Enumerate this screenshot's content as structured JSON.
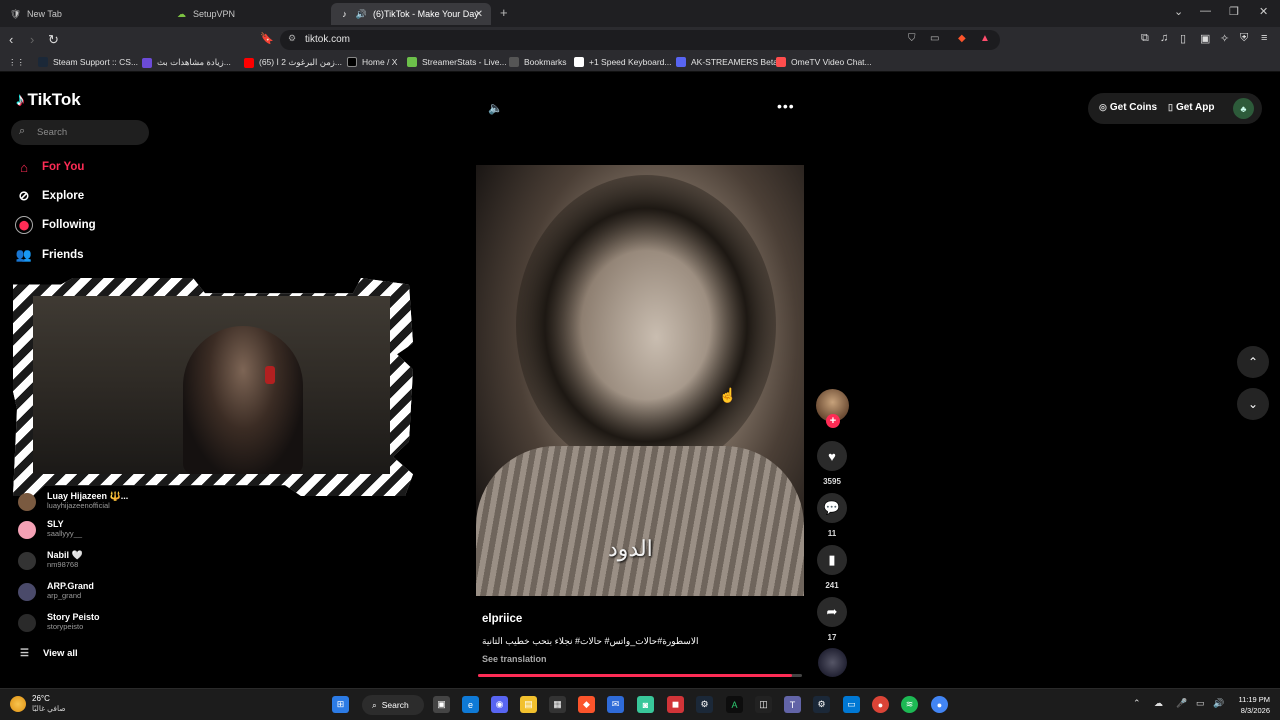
{
  "browser": {
    "tabs": [
      {
        "title": "New Tab",
        "active": false
      },
      {
        "title": "SetupVPN",
        "active": false
      },
      {
        "title": "(6)TikTok - Make Your Day",
        "active": true
      }
    ],
    "url": "tiktok.com",
    "bookmarks": [
      {
        "label": "Steam Support :: CS...",
        "color": "#1b2838"
      },
      {
        "label": "زيادة مشاهدات بث...",
        "color": "#6c4bd8"
      },
      {
        "label": "(65) زمن البرغوث 2 ا...",
        "color": "#ff0000"
      },
      {
        "label": "Home / X",
        "color": "#000000"
      },
      {
        "label": "StreamerStats - Live...",
        "color": "#6cc04a"
      },
      {
        "label": "Bookmarks",
        "color": "#555555"
      },
      {
        "label": "+1 Speed Keyboard...",
        "color": "#ffffff"
      },
      {
        "label": "AK-STREAMERS Beta",
        "color": "#5865f2"
      },
      {
        "label": "OmeTV Video Chat...",
        "color": "#ff4d4d"
      }
    ]
  },
  "tiktok": {
    "logo": "TikTok",
    "search_placeholder": "Search",
    "nav": [
      {
        "label": "For You",
        "icon": "home-icon",
        "active": true
      },
      {
        "label": "Explore",
        "icon": "compass-icon",
        "active": false
      },
      {
        "label": "Following",
        "icon": "following-icon",
        "active": false
      },
      {
        "label": "Friends",
        "icon": "friends-icon",
        "active": false
      }
    ],
    "following_accounts": [
      {
        "name": "Luay Hijazeen 🔱...",
        "handle": "luayhijazeenofficial",
        "color": "#7a5a40"
      },
      {
        "name": "SLY",
        "handle": "saallyyy__",
        "color": "#f4a1b5"
      },
      {
        "name": "Nabil 🤍",
        "handle": "nm98768",
        "color": "#333333"
      },
      {
        "name": "ARP.Grand",
        "handle": "arp_grand",
        "color": "#4a4a6a"
      },
      {
        "name": "Story Peisto",
        "handle": "storypeisto",
        "color": "#2a2a2a"
      }
    ],
    "view_all": "View all",
    "top_right": {
      "coins": "Get Coins",
      "app": "Get App"
    },
    "video": {
      "author": "elpriice",
      "description": "الاسطورة#حالات_واتس# حالات# نجلاء بتحب خطيب التانية",
      "see_translation": "See translation",
      "overlay_text": "الدود",
      "progress": 0.97,
      "likes": "3595",
      "comments": "11",
      "saves": "241",
      "shares": "17"
    }
  },
  "taskbar": {
    "weather_temp": "26°C",
    "weather_desc": "صافي غالبًا",
    "search_label": "Search",
    "time": "11:19 PM",
    "date": "8/3/2026"
  },
  "colors": {
    "accent": "#fe2c55",
    "background": "#000000"
  }
}
